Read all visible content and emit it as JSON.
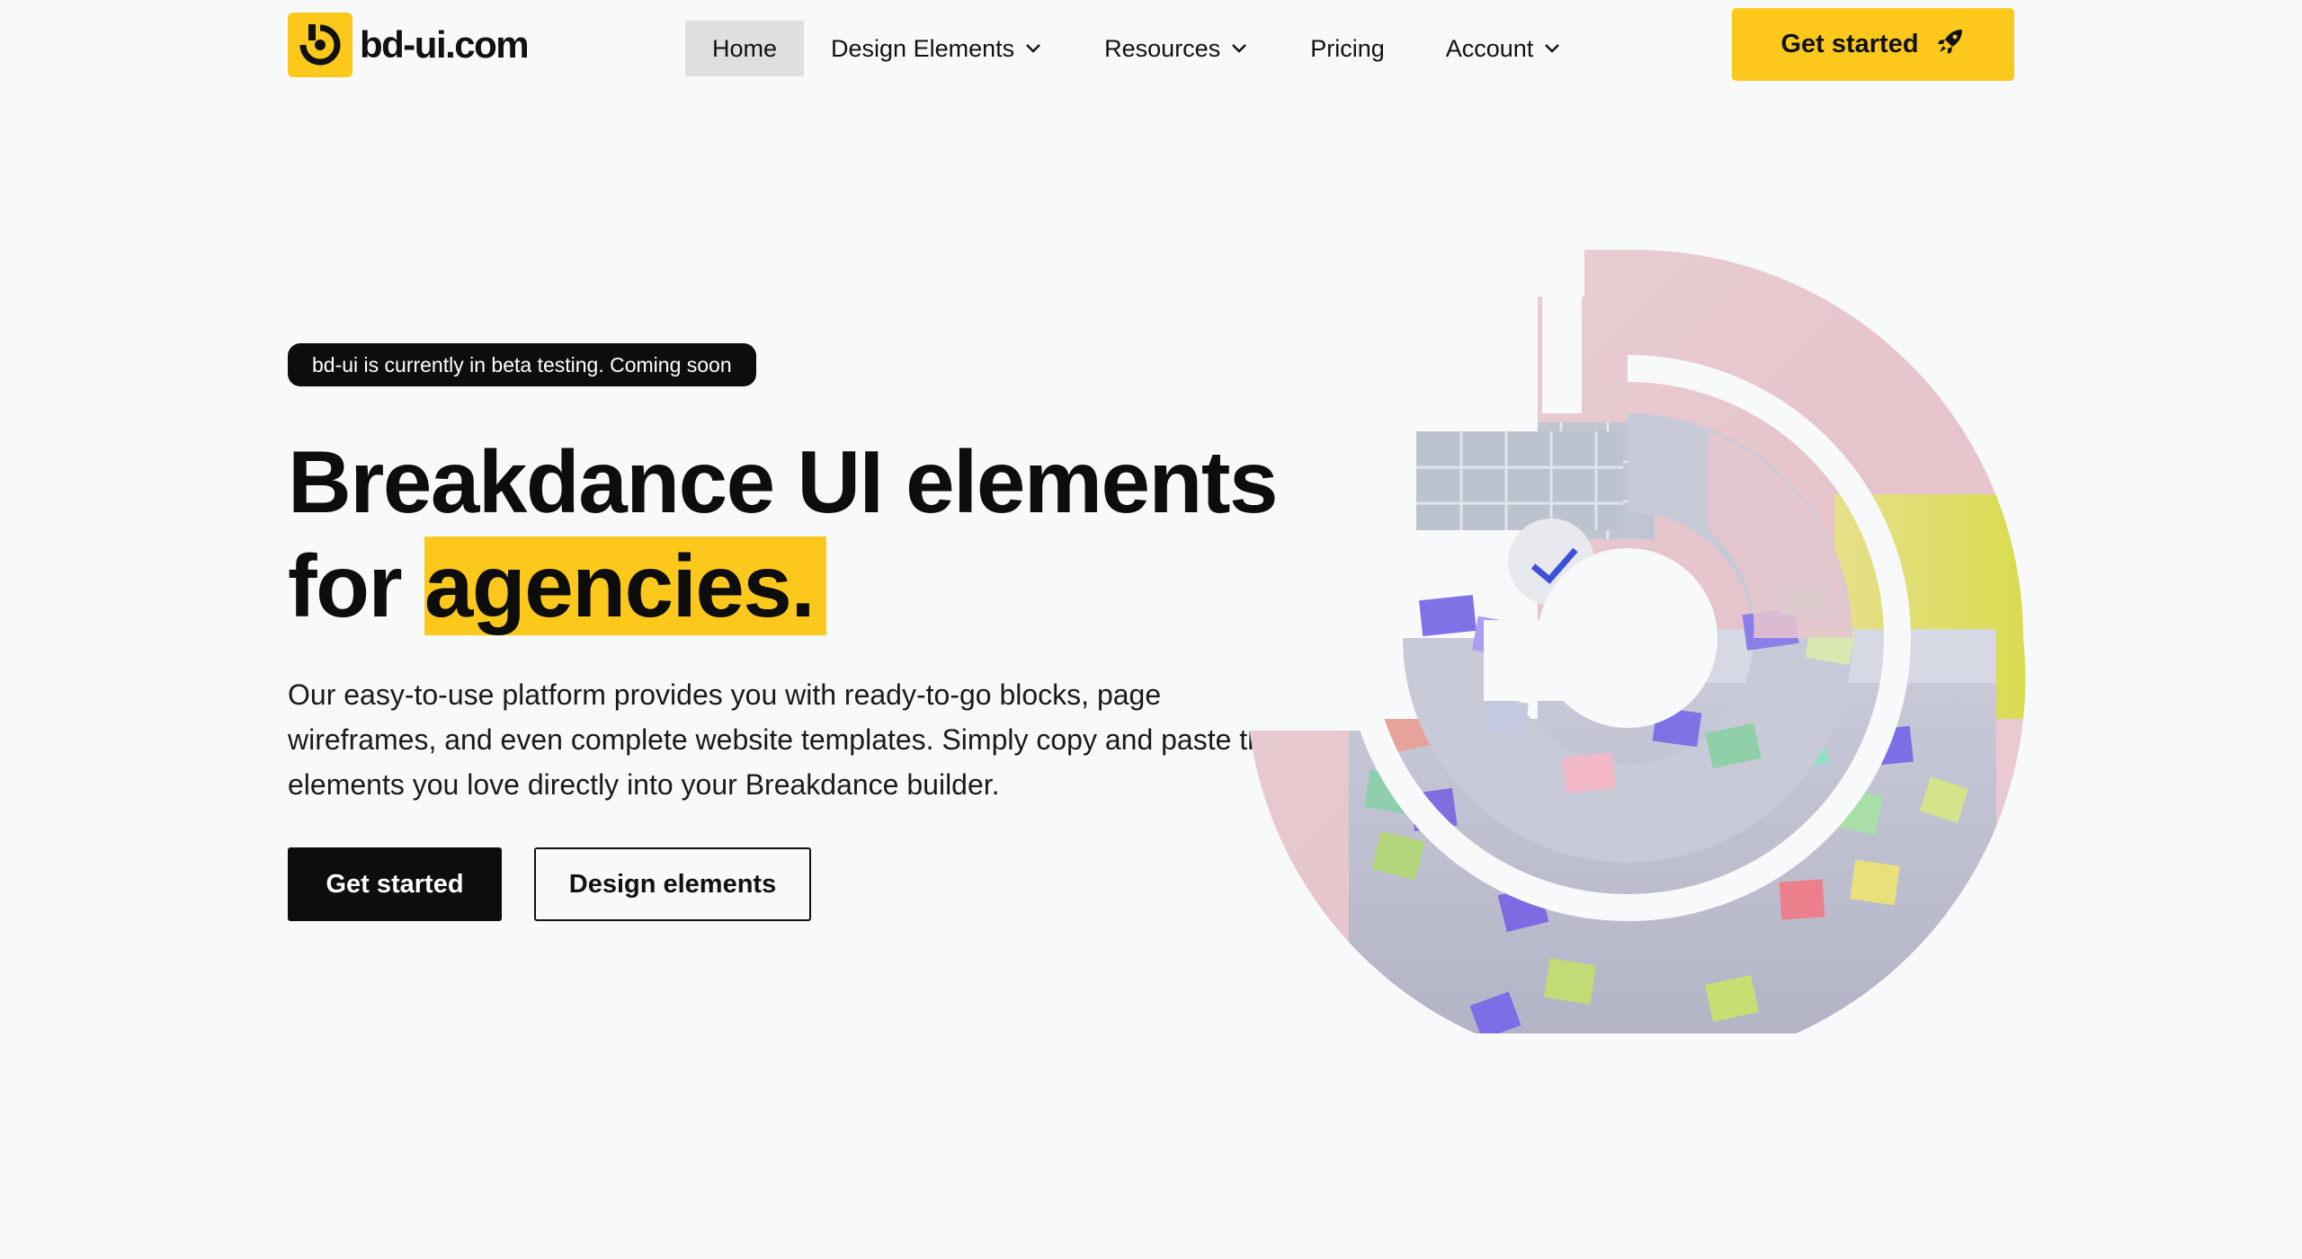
{
  "brand": {
    "name": "bd-ui.com",
    "accent": "#fcc81c",
    "dark": "#0d0d0d",
    "background": "#f8f9fa"
  },
  "nav": {
    "items": [
      {
        "label": "Home",
        "active": true,
        "dropdown": false
      },
      {
        "label": "Design Elements",
        "active": false,
        "dropdown": true
      },
      {
        "label": "Resources",
        "active": false,
        "dropdown": true
      },
      {
        "label": "Pricing",
        "active": false,
        "dropdown": false
      },
      {
        "label": "Account",
        "active": false,
        "dropdown": true
      }
    ],
    "cta_label": "Get started",
    "cta_icon": "rocket-icon"
  },
  "hero": {
    "badge": "bd-ui is currently in beta testing. Coming soon",
    "headline_line1": "Breakdance UI elements",
    "headline_line2_prefix": "for ",
    "headline_highlight": "agencies.",
    "lede": "Our easy-to-use platform provides you with ready-to-go blocks, page wireframes, and even complete website templates. Simply copy and paste the elements you love directly into your Breakdance builder.",
    "primary_button": "Get started",
    "secondary_button": "Design elements"
  }
}
